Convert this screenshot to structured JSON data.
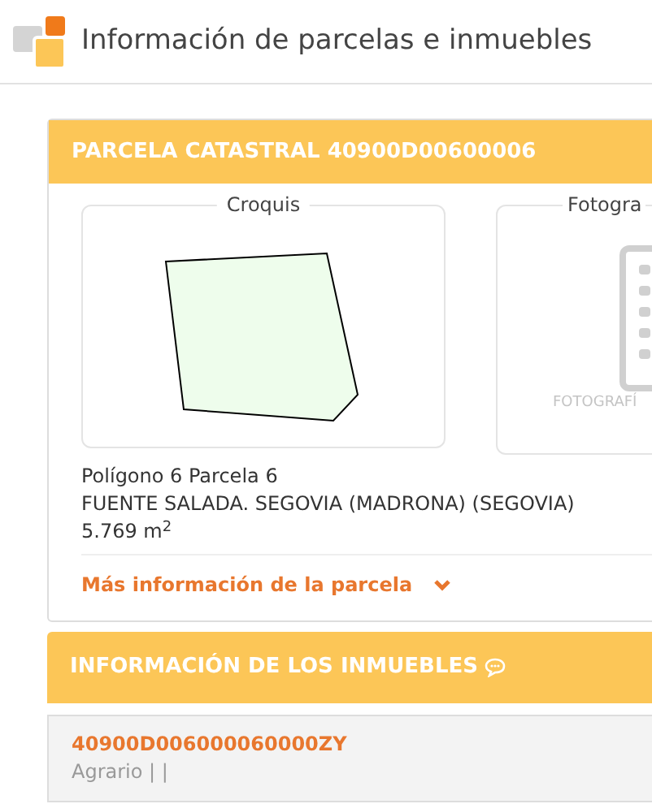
{
  "header": {
    "title": "Información de parcelas e inmuebles"
  },
  "parcel": {
    "title": "PARCELA CATASTRAL 40900D00600006",
    "sketch": {
      "label": "Croquis"
    },
    "photo": {
      "label": "Fotogra",
      "placeholder_text": "FOTOGRAFÍ"
    },
    "lines": [
      "Polígono 6 Parcela 6",
      "FUENTE SALADA. SEGOVIA (MADRONA) (SEGOVIA)",
      "5.769 m$^{2}$"
    ],
    "more_link": {
      "label": "Más información de la parcela",
      "expanded": false
    }
  },
  "properties": {
    "title": "INFORMACIÓN DE LOS INMUEBLES",
    "items": [
      {
        "reference": "40900D006000060000ZY",
        "use": "Agrario | |"
      }
    ]
  }
}
